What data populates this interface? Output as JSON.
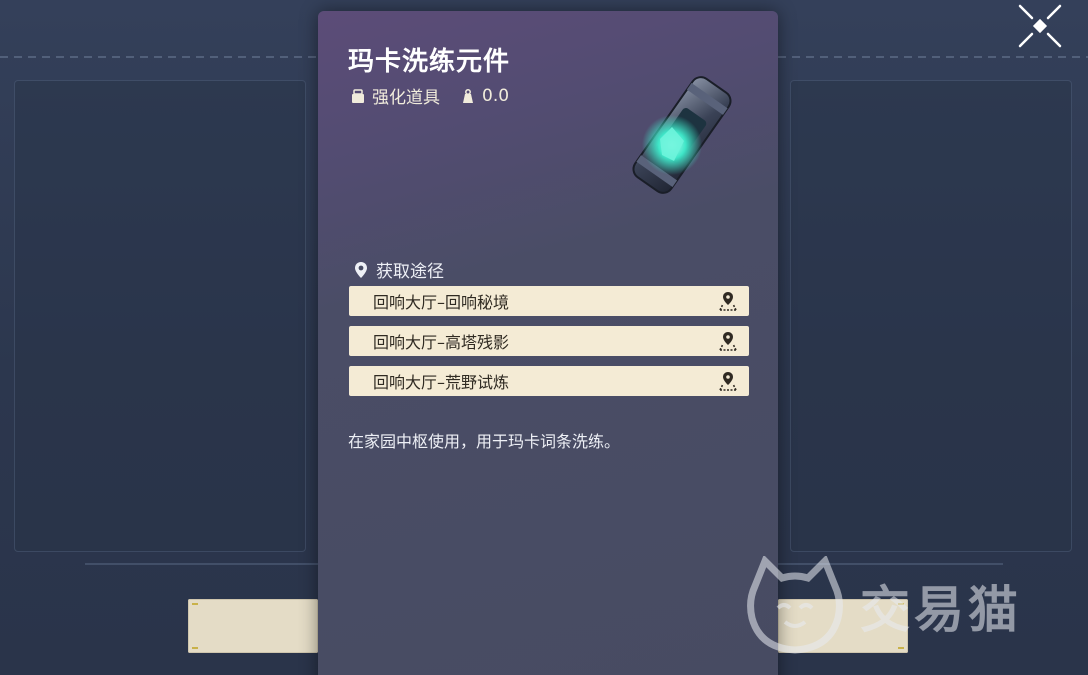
{
  "item": {
    "name": "玛卡洗练元件",
    "category": "强化道具",
    "weight": "0.0",
    "icon": "cyan-crystal-canister-icon"
  },
  "sources": {
    "header": "获取途径",
    "items": [
      {
        "label": "回响大厅–回响秘境"
      },
      {
        "label": "回响大厅–高塔残影"
      },
      {
        "label": "回响大厅–荒野试炼"
      }
    ]
  },
  "description": "在家园中枢使用，用于玛卡词条洗练。",
  "watermark": {
    "text": "交易猫"
  },
  "colors": {
    "card_top": "#5c4c78",
    "card_bottom": "#474b62",
    "source_bg": "#f4ebd5",
    "accent_cyan": "#3fe6c8"
  }
}
